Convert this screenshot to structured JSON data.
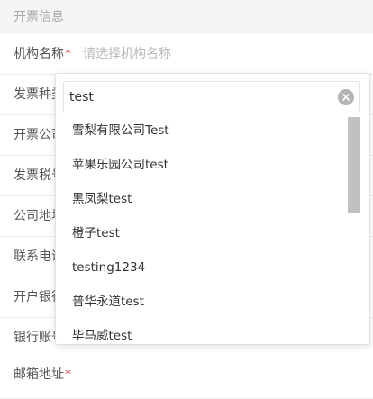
{
  "section": {
    "title": "开票信息"
  },
  "form": {
    "rows": [
      {
        "label": "机构名称",
        "required": "*",
        "value": "请选择机构名称"
      },
      {
        "label": "发票种类",
        "required": "",
        "value": ""
      },
      {
        "label": "开票公司",
        "required": "",
        "value": ""
      },
      {
        "label": "发票税号",
        "required": "",
        "value": ""
      },
      {
        "label": "公司地址",
        "required": "",
        "value": ""
      },
      {
        "label": "联系电话",
        "required": "",
        "value": ""
      },
      {
        "label": "开户银行",
        "required": "",
        "value": ""
      },
      {
        "label": "银行账号",
        "required": "",
        "value": ""
      },
      {
        "label": "邮箱地址",
        "required": "*",
        "value": ""
      }
    ]
  },
  "dropdown": {
    "search_value": "test",
    "options": [
      "雪梨有限公司Test",
      "苹果乐园公司test",
      "黑凤梨test",
      "橙子test",
      "testing1234",
      "普华永道test",
      "毕马威test"
    ]
  },
  "colors": {
    "required": "#e64340",
    "placeholder": "#b9b9b9",
    "header_bg": "#f5f5f5"
  }
}
